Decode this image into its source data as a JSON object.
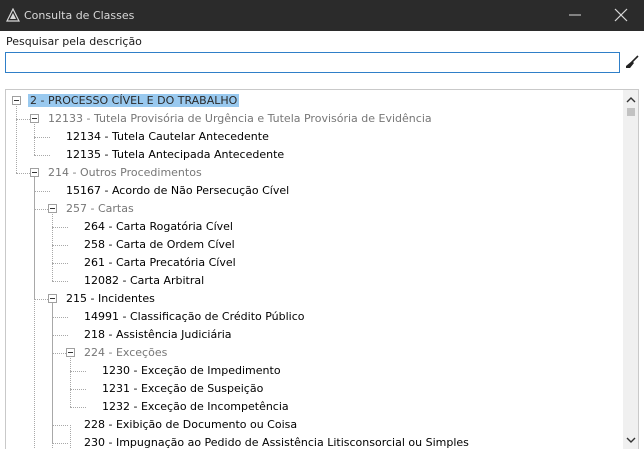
{
  "window": {
    "title": "Consulta de Classes",
    "icon": "app-triangle-icon"
  },
  "search": {
    "label": "Pesquisar pela descrição",
    "value": "",
    "placeholder": "",
    "clear_icon": "broom-icon"
  },
  "tree": {
    "nodes": [
      {
        "text": "2 - PROCESSO CÍVEL E DO TRABALHO",
        "style": "selected",
        "expanded": true
      },
      {
        "text": "12133 - Tutela Provisória de Urgência e Tutela Provisória de Evidência",
        "style": "gray",
        "expanded": true
      },
      {
        "text": "12134 - Tutela Cautelar Antecedente",
        "style": "normal"
      },
      {
        "text": "12135 - Tutela Antecipada Antecedente",
        "style": "normal"
      },
      {
        "text": "214 - Outros Procedimentos",
        "style": "gray",
        "expanded": true
      },
      {
        "text": "15167 - Acordo de Não Persecução Cível",
        "style": "normal"
      },
      {
        "text": "257 - Cartas",
        "style": "gray",
        "expanded": true
      },
      {
        "text": "264 - Carta Rogatória Cível",
        "style": "normal"
      },
      {
        "text": "258 - Carta de Ordem Cível",
        "style": "normal"
      },
      {
        "text": "261 - Carta Precatória Cível",
        "style": "normal"
      },
      {
        "text": "12082 - Carta Arbitral",
        "style": "normal"
      },
      {
        "text": "215 - Incidentes",
        "style": "normal",
        "expanded": true
      },
      {
        "text": "14991 - Classificação de Crédito Público",
        "style": "normal"
      },
      {
        "text": "218 - Assistência Judiciária",
        "style": "normal"
      },
      {
        "text": "224 - Exceções",
        "style": "gray",
        "expanded": true
      },
      {
        "text": "1230 - Exceção de Impedimento",
        "style": "normal"
      },
      {
        "text": "1231 - Exceção de Suspeição",
        "style": "normal"
      },
      {
        "text": "1232 - Exceção de Incompetência",
        "style": "normal"
      },
      {
        "text": "228 - Exibição de Documento ou Coisa",
        "style": "normal"
      },
      {
        "text": "230 - Impugnação ao Pedido de Assistência Litisconsorcial ou Simples",
        "style": "normal"
      }
    ]
  },
  "colors": {
    "selection": "#99c9ef",
    "titlebar": "#2b2b2b",
    "focus_border": "#2f7fc8"
  }
}
